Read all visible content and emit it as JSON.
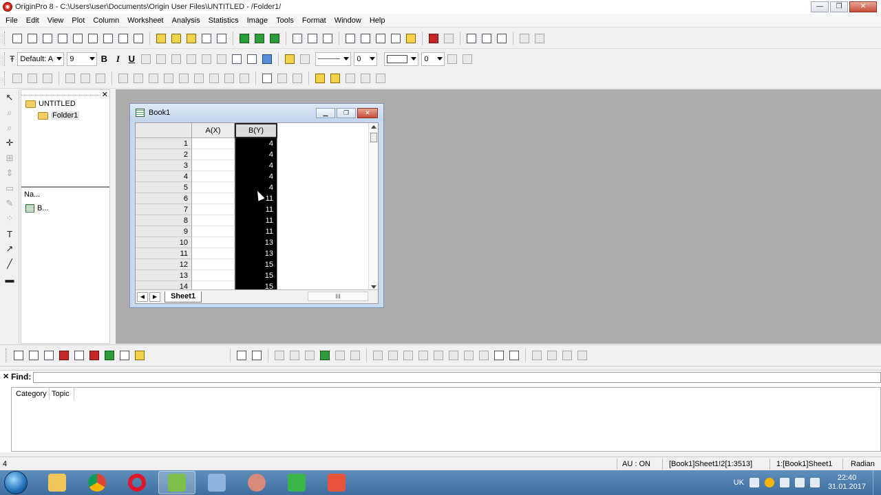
{
  "window": {
    "title": "OriginPro 8 - C:\\Users\\user\\Documents\\Origin User Files\\UNTITLED - /Folder1/"
  },
  "menu": [
    "File",
    "Edit",
    "View",
    "Plot",
    "Column",
    "Worksheet",
    "Analysis",
    "Statistics",
    "Image",
    "Tools",
    "Format",
    "Window",
    "Help"
  ],
  "format_toolbar": {
    "font_name": "Default: A",
    "font_size": "9",
    "bold": "B",
    "italic": "I",
    "underline": "U",
    "line_width": "0",
    "fill_value": "0"
  },
  "explorer": {
    "root": "UNTITLED",
    "folder": "Folder1",
    "column_header": "Na...",
    "items": [
      "B..."
    ]
  },
  "book": {
    "title": "Book1",
    "columns": [
      "A(X)",
      "B(Y)"
    ],
    "rows": [
      {
        "n": "1",
        "b": "4"
      },
      {
        "n": "2",
        "b": "4"
      },
      {
        "n": "3",
        "b": "4"
      },
      {
        "n": "4",
        "b": "4"
      },
      {
        "n": "5",
        "b": "4"
      },
      {
        "n": "6",
        "b": "11"
      },
      {
        "n": "7",
        "b": "11"
      },
      {
        "n": "8",
        "b": "11"
      },
      {
        "n": "9",
        "b": "11"
      },
      {
        "n": "10",
        "b": "13"
      },
      {
        "n": "11",
        "b": "13"
      },
      {
        "n": "12",
        "b": "15"
      },
      {
        "n": "13",
        "b": "15"
      },
      {
        "n": "14",
        "b": "15"
      }
    ],
    "sheet_tab": "Sheet1",
    "hscroll_label": "III"
  },
  "find": {
    "label": "Find:",
    "value": "",
    "columns": [
      "Category",
      "Topic"
    ]
  },
  "status": {
    "left": "4",
    "au": "AU : ON",
    "cell": "[Book1]Sheet1!2[1:3513]",
    "sheet": "1:[Book1]Sheet1",
    "angle": "Radian"
  },
  "taskbar": {
    "lang": "UK",
    "time": "22:40",
    "date": "31.01.2017"
  },
  "colors": {
    "selected_column": "#000000",
    "mdi_background": "#acacac",
    "taskbar": "#4a7aa8"
  }
}
